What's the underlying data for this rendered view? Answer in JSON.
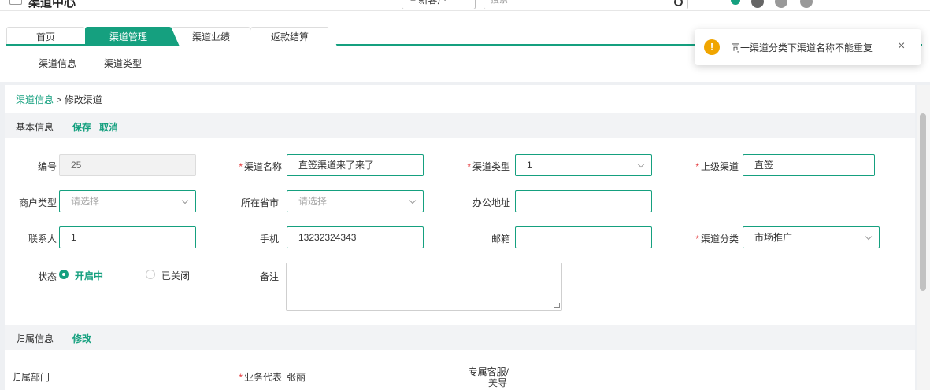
{
  "app": {
    "title": "渠道中心"
  },
  "topbar": {
    "new_button": "+ 新客户",
    "search_placeholder": "搜索"
  },
  "tabs": [
    {
      "label": "首页"
    },
    {
      "label": "渠道管理"
    },
    {
      "label": "渠道业绩"
    },
    {
      "label": "返款结算"
    }
  ],
  "subnav": [
    {
      "label": "渠道信息"
    },
    {
      "label": "渠道类型"
    }
  ],
  "breadcrumb": {
    "parent": "渠道信息",
    "separator": " > ",
    "current": "修改渠道"
  },
  "basic_section": {
    "title": "基本信息",
    "save": "保存",
    "cancel": "取消"
  },
  "form": {
    "id": {
      "label": "编号",
      "value": "25"
    },
    "name": {
      "label": "渠道名称",
      "value": "直签渠道来了来了"
    },
    "type": {
      "label": "渠道类型",
      "value": "1"
    },
    "parent": {
      "label": "上级渠道",
      "value": "直签"
    },
    "merchant_type": {
      "label": "商户类型",
      "placeholder": "请选择"
    },
    "province": {
      "label": "所在省市",
      "placeholder": "请选择"
    },
    "address": {
      "label": "办公地址",
      "value": ""
    },
    "contact": {
      "label": "联系人",
      "value": "1"
    },
    "phone": {
      "label": "手机",
      "value": "13232324343"
    },
    "email": {
      "label": "邮箱",
      "value": ""
    },
    "category": {
      "label": "渠道分类",
      "value": "市场推广"
    },
    "status": {
      "label": "状态",
      "options": [
        "开启中",
        "已关闭"
      ],
      "selected": "开启中"
    },
    "remark": {
      "label": "备注",
      "value": ""
    }
  },
  "ownership_section": {
    "title": "归属信息",
    "edit": "修改"
  },
  "ownership": {
    "department": {
      "label": "归属部门",
      "value": ""
    },
    "rep": {
      "label": "业务代表",
      "value": "张丽"
    },
    "service": {
      "label_line1": "专属客服/",
      "label_line2": "美导",
      "value": ""
    }
  },
  "toast": {
    "message": "同一渠道分类下渠道名称不能重复",
    "close": "×",
    "icon": "!"
  },
  "colors": {
    "accent": "#15a07f",
    "required": "#e4393c",
    "warning": "#f0a500"
  }
}
